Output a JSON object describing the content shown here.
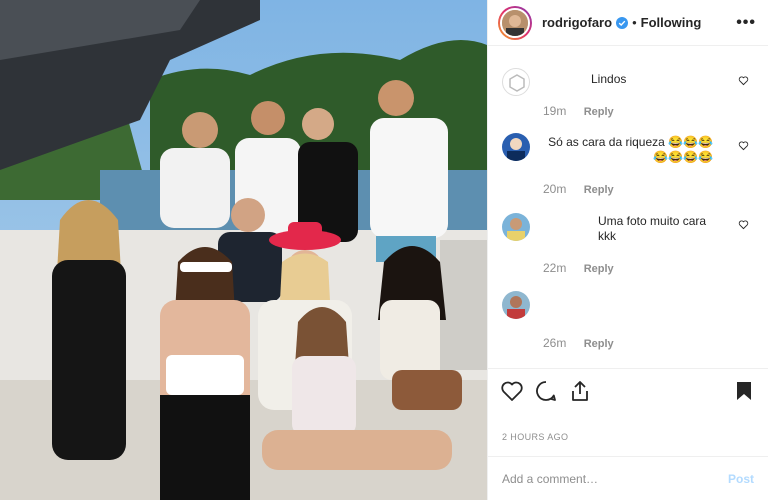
{
  "post": {
    "username": "rodrigofaro",
    "separator": "•",
    "follow_state": "Following",
    "more": "•••"
  },
  "comments": [
    {
      "text": "Lindos",
      "time": "19m",
      "reply": "Reply"
    },
    {
      "text": "Só as cara da riqueza 😂😂😂😂😂😂😂",
      "time": "20m",
      "reply": "Reply"
    },
    {
      "text": "Uma foto muito cara kkk",
      "time": "22m",
      "reply": "Reply"
    },
    {
      "text": "",
      "time": "26m",
      "reply": "Reply"
    }
  ],
  "timestamp": "2 HOURS AGO",
  "add_comment": {
    "placeholder": "Add a comment…",
    "post_label": "Post"
  },
  "colors": {
    "verified": "#3897f0",
    "post_disabled": "#b3dbff",
    "meta": "#8e8e8e"
  },
  "icons": [
    "heart-icon",
    "comment-icon",
    "share-icon",
    "bookmark-icon",
    "verified-icon",
    "more-icon"
  ]
}
